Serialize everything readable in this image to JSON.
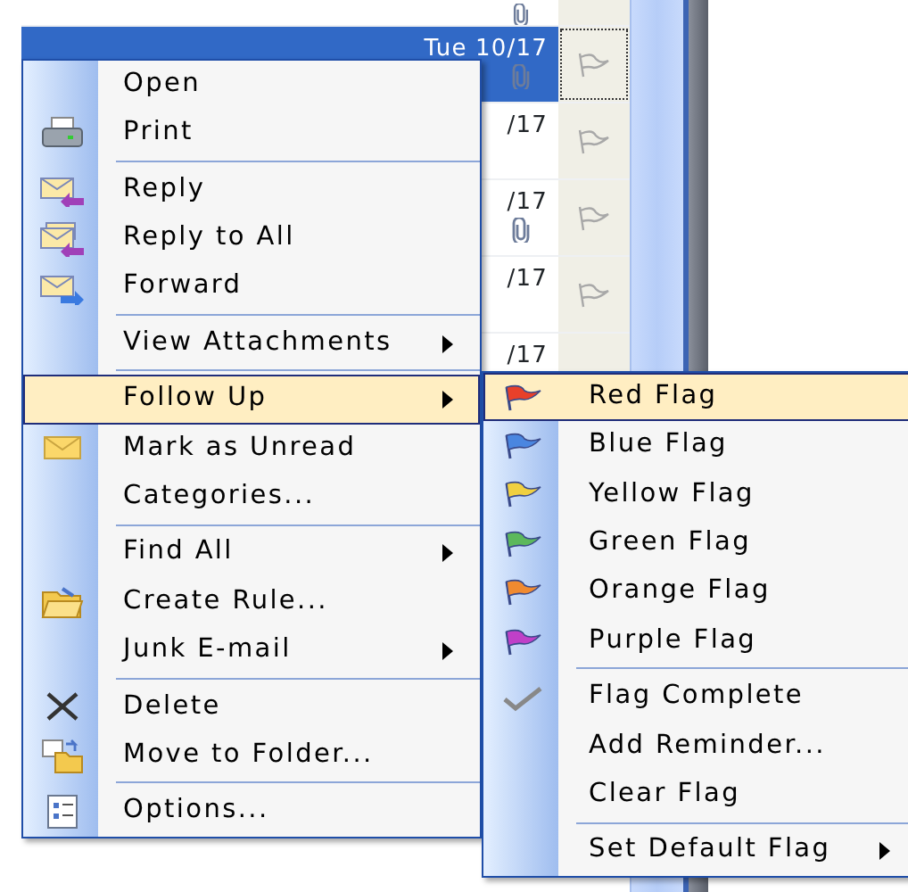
{
  "message_list": {
    "rows": [
      {
        "date": "",
        "attachment": true,
        "selected": false
      },
      {
        "date": "Tue 10/17",
        "attachment": true,
        "selected": true
      },
      {
        "date": "/17",
        "attachment": false,
        "selected": false
      },
      {
        "date": "/17",
        "attachment": true,
        "selected": false
      },
      {
        "date": "/17",
        "attachment": false,
        "selected": false
      },
      {
        "date": "/17",
        "attachment": false,
        "selected": false
      }
    ]
  },
  "context_menu": {
    "items": [
      {
        "kind": "item",
        "label": "Open",
        "submenu": false,
        "selected": false
      },
      {
        "kind": "item",
        "label": "Print",
        "submenu": false,
        "selected": false
      },
      {
        "kind": "separator"
      },
      {
        "kind": "item",
        "label": "Reply",
        "submenu": false,
        "selected": false
      },
      {
        "kind": "item",
        "label": "Reply to All",
        "submenu": false,
        "selected": false
      },
      {
        "kind": "item",
        "label": "Forward",
        "submenu": false,
        "selected": false
      },
      {
        "kind": "separator"
      },
      {
        "kind": "item",
        "label": "View Attachments",
        "submenu": true,
        "selected": false
      },
      {
        "kind": "separator"
      },
      {
        "kind": "item",
        "label": "Follow Up",
        "submenu": true,
        "selected": true
      },
      {
        "kind": "item",
        "label": "Mark as Unread",
        "submenu": false,
        "selected": false
      },
      {
        "kind": "item",
        "label": "Categories...",
        "submenu": false,
        "selected": false
      },
      {
        "kind": "separator"
      },
      {
        "kind": "item",
        "label": "Find All",
        "submenu": true,
        "selected": false
      },
      {
        "kind": "item",
        "label": "Create Rule...",
        "submenu": false,
        "selected": false
      },
      {
        "kind": "item",
        "label": "Junk E-mail",
        "submenu": true,
        "selected": false
      },
      {
        "kind": "separator"
      },
      {
        "kind": "item",
        "label": "Delete",
        "submenu": false,
        "selected": false
      },
      {
        "kind": "item",
        "label": "Move to Folder...",
        "submenu": false,
        "selected": false
      },
      {
        "kind": "separator"
      },
      {
        "kind": "item",
        "label": "Options...",
        "submenu": false,
        "selected": false
      }
    ]
  },
  "follow_up_menu": {
    "items": [
      {
        "kind": "flag",
        "label": "Red Flag",
        "color": "#e8402a",
        "submenu": false,
        "selected": true
      },
      {
        "kind": "flag",
        "label": "Blue Flag",
        "color": "#4a86e0",
        "submenu": false,
        "selected": false
      },
      {
        "kind": "flag",
        "label": "Yellow Flag",
        "color": "#f0d040",
        "submenu": false,
        "selected": false
      },
      {
        "kind": "flag",
        "label": "Green Flag",
        "color": "#5cb85c",
        "submenu": false,
        "selected": false
      },
      {
        "kind": "flag",
        "label": "Orange Flag",
        "color": "#f08a30",
        "submenu": false,
        "selected": false
      },
      {
        "kind": "flag",
        "label": "Purple Flag",
        "color": "#c040c8",
        "submenu": false,
        "selected": false
      },
      {
        "kind": "separator"
      },
      {
        "kind": "check",
        "label": "Flag Complete",
        "submenu": false,
        "selected": false
      },
      {
        "kind": "item",
        "label": "Add Reminder...",
        "submenu": false,
        "selected": false
      },
      {
        "kind": "item",
        "label": "Clear Flag",
        "submenu": false,
        "selected": false
      },
      {
        "kind": "separator"
      },
      {
        "kind": "item",
        "label": "Set Default Flag",
        "submenu": true,
        "selected": false
      }
    ]
  }
}
